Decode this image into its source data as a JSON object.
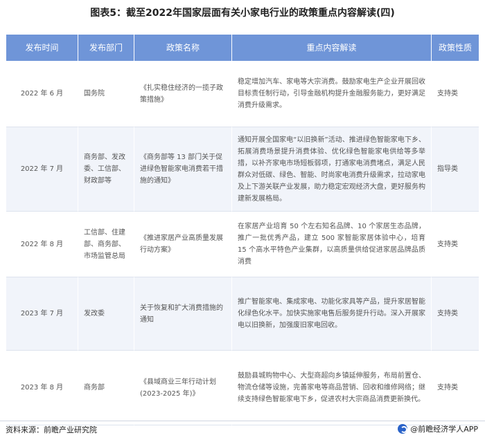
{
  "title": "图表5：截至2022年国家层面有关小家电行业的政策重点内容解读(四)",
  "table": {
    "headers": [
      "发布时间",
      "发布部门",
      "政策名称",
      "重点内容解读",
      "政策性质"
    ],
    "rows": [
      {
        "date": "2022 年 6 月",
        "dept": "国务院",
        "name": "《扎实稳住经济的一揽子政策措施》",
        "content": "稳定增加汽车、家电等大宗消费。鼓励家电生产企业开展回收目标责任制行动，引导金融机构提升金融服务能力，更好满足消费升级需求。",
        "nature": "支持类"
      },
      {
        "date": "2022 年 7 月",
        "dept": "商务部、发改委、工信部、财政部等",
        "name": "《商务部等 13 部门关于促进绿色智能家电消费若干措施的通知》",
        "content": "通知开展全国家电“以旧换新”活动、推进绿色智能家电下乡、拓展消费场景提升消费体验、优化绿色智能家电供给等多举措，以补齐家电市场短板弱项，打通家电消费堵点，满足人民群众对低碳、绿色、智能、时尚家电消费升级需求，拉动家电及上下游关联产业发展，助力稳定宏观经济大盘，更好服务构建新发展格局。",
        "nature": "指导类"
      },
      {
        "date": "2022 年 8 月",
        "dept": "工信部、住建部、商务部、市场监管总局",
        "name": "《推进家居产业高质量发展行动方案》",
        "content": "在家居产业培育 50 个左右知名品牌、10 个家居生态品牌，推广一批优秀产品，建立 500 家智能家居体验中心，培育 15 个高水平特色产业集群，以高质量供给促进家居品牌品质消费",
        "nature": "支持类"
      },
      {
        "date": "2023 年 7 月",
        "dept": "发改委",
        "name": "关于恢复和扩大消费措施的通知",
        "content": "推广智能家电、集成家电、功能化家具等产品，提升家居智能化绿色化水平。加快实施家电售后服务提升行动。深入开展家电以旧换新，加强废旧家电回收。",
        "nature": "支持类"
      },
      {
        "date": "2023 年 8 月",
        "dept": "商务部",
        "name": "《县域商业三年行动计划(2023-2025 年)》",
        "content": "鼓励县城购物中心、大型商超向乡镇延伸服务，布局前置仓、物流仓储等设施，完善家电等商品营销、回收和维修网络；继续支持绿色智能家电下乡，促进农村大宗商品消费更新换代。",
        "nature": "支持类"
      }
    ]
  },
  "footer": {
    "source": "资料来源：前瞻产业研究院",
    "brand": "@前瞻经济学人APP"
  }
}
